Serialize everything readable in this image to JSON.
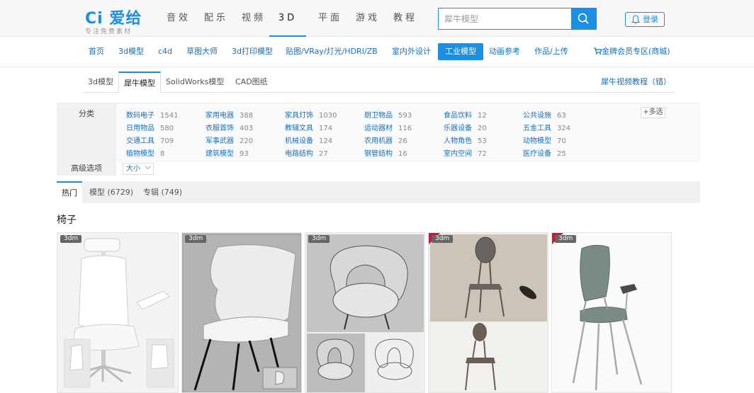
{
  "header": {
    "logo_main": "Ci 爱给",
    "logo_sub": "专注免费素材",
    "nav": [
      "音效",
      "配乐",
      "视频",
      "3D",
      "平面",
      "游戏",
      "教程"
    ],
    "active_nav": "3D",
    "search_placeholder": "犀牛模型",
    "login_label": "登录"
  },
  "category_nav": {
    "items": [
      "首页",
      "3d模型",
      "c4d",
      "草图大师",
      "3d打印模型",
      "贴图/VRay/灯光/HDRI/ZB",
      "室内外设计",
      "工业模型",
      "动画参考",
      "作品/上传"
    ],
    "active": "工业模型",
    "vip_label": "金牌会员专区(商城)"
  },
  "sub_tabs": {
    "items": [
      "3d模型",
      "犀牛模型",
      "SolidWorks模型",
      "CAD图纸"
    ],
    "active": "犀牛模型",
    "right_link": "犀牛视频教程（错）"
  },
  "filter": {
    "label": "分类",
    "multi_select": "+多选",
    "items": [
      {
        "name": "数码电子",
        "count": "1541"
      },
      {
        "name": "家用电器",
        "count": "388"
      },
      {
        "name": "家具灯饰",
        "count": "1030"
      },
      {
        "name": "厨卫物品",
        "count": "593"
      },
      {
        "name": "食品饮料",
        "count": "12"
      },
      {
        "name": "公共设施",
        "count": "63"
      },
      {
        "name": "日用物品",
        "count": "580"
      },
      {
        "name": "衣服首饰",
        "count": "403"
      },
      {
        "name": "教辅文具",
        "count": "174"
      },
      {
        "name": "运动器材",
        "count": "116"
      },
      {
        "name": "乐器设备",
        "count": "20"
      },
      {
        "name": "五金工具",
        "count": "324"
      },
      {
        "name": "交通工具",
        "count": "709"
      },
      {
        "name": "军事武器",
        "count": "220"
      },
      {
        "name": "机械设备",
        "count": "124"
      },
      {
        "name": "农用机器",
        "count": "26"
      },
      {
        "name": "人物角色",
        "count": "53"
      },
      {
        "name": "动物模型",
        "count": "70"
      },
      {
        "name": "植物模型",
        "count": "8"
      },
      {
        "name": "建筑模型",
        "count": "93"
      },
      {
        "name": "电路结构",
        "count": "27"
      },
      {
        "name": "钢管结构",
        "count": "16"
      },
      {
        "name": "室内空间",
        "count": "72"
      },
      {
        "name": "医疗设备",
        "count": "25"
      }
    ],
    "advanced_label": "高级选项",
    "size_select": "大小"
  },
  "result_tabs": {
    "items": [
      "热门",
      "模型 (6729)",
      "专辑 (749)"
    ],
    "active": "热门"
  },
  "section_title": "椅子",
  "cards": [
    {
      "badge": "3dm",
      "red_corner": false
    },
    {
      "badge": "3dm",
      "red_corner": false
    },
    {
      "badge": "3dm",
      "red_corner": false
    },
    {
      "badge": "3dm",
      "red_corner": true
    },
    {
      "badge": "3dm",
      "red_corner": true
    }
  ],
  "colors": {
    "accent": "#1a8fe3",
    "link": "#1a6fb8",
    "red_corner": "#d2143c"
  },
  "icons": {
    "search": "search-icon",
    "login": "bell-icon",
    "cart": "cart-icon",
    "dropdown": "chevron-down-icon"
  }
}
